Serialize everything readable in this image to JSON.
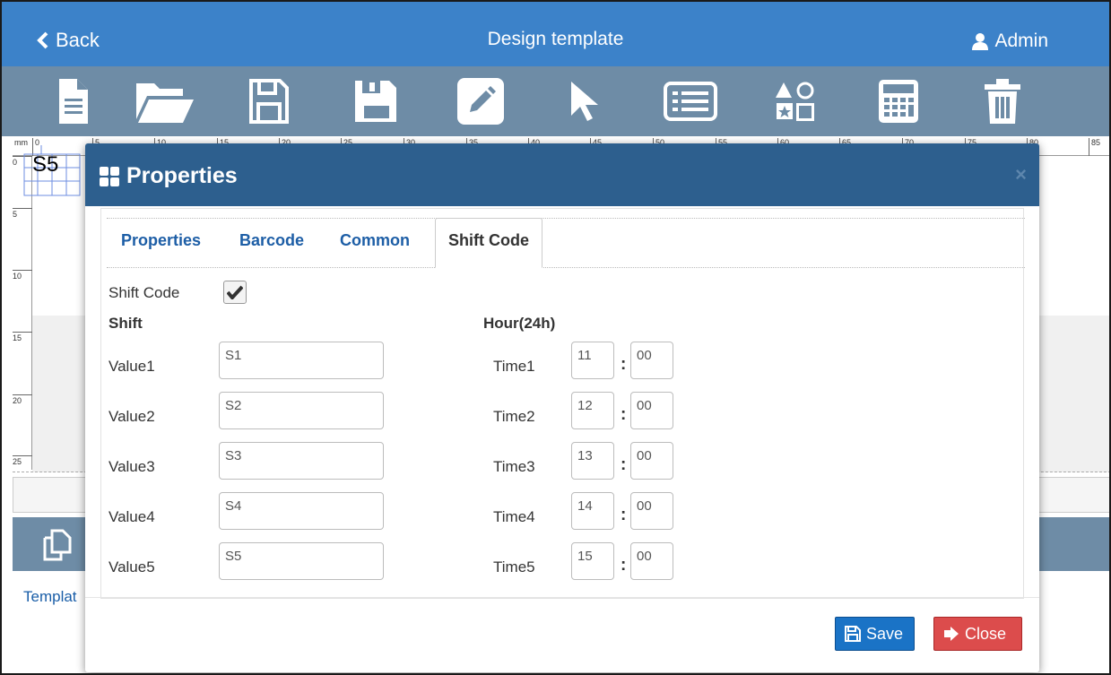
{
  "header": {
    "back_label": "Back",
    "title": "Design template",
    "user_label": "Admin"
  },
  "colors": {
    "header_bg": "#3c82c9",
    "toolbar_bg": "#6e8ca6",
    "modal_header_bg": "#2d5f8e",
    "link": "#1d5ea6",
    "save_bg": "#1a73c6",
    "close_bg": "#dc4c4c"
  },
  "toolbar": {
    "icons": [
      "file-icon",
      "folder-open-icon",
      "save-icon",
      "save-as-icon",
      "edit-icon",
      "pointer-icon",
      "list-icon",
      "shapes-icon",
      "calculator-icon",
      "trash-icon"
    ]
  },
  "ruler": {
    "unit": "mm",
    "top_ticks": [
      "0",
      "5",
      "10",
      "15",
      "20",
      "25",
      "30",
      "35",
      "40",
      "45",
      "50",
      "55",
      "60",
      "65",
      "70",
      "75",
      "80",
      "85"
    ],
    "left_ticks": [
      "0",
      "5",
      "10",
      "15",
      "20",
      "25"
    ]
  },
  "canvas": {
    "object_text": "S5"
  },
  "footer": {
    "template_link": "Templat"
  },
  "modal": {
    "title": "Properties",
    "close_glyph": "×",
    "tabs": [
      "Properties",
      "Barcode",
      "Common",
      "Shift Code"
    ],
    "active_tab": "Shift Code",
    "shift_code_label": "Shift Code",
    "shift_code_checked": true,
    "shift_header": "Shift",
    "hour_header": "Hour(24h)",
    "rows": [
      {
        "value_label": "Value1",
        "value": "S1",
        "time_label": "Time1",
        "hour": "11",
        "minute": "00"
      },
      {
        "value_label": "Value2",
        "value": "S2",
        "time_label": "Time2",
        "hour": "12",
        "minute": "00"
      },
      {
        "value_label": "Value3",
        "value": "S3",
        "time_label": "Time3",
        "hour": "13",
        "minute": "00"
      },
      {
        "value_label": "Value4",
        "value": "S4",
        "time_label": "Time4",
        "hour": "14",
        "minute": "00"
      },
      {
        "value_label": "Value5",
        "value": "S5",
        "time_label": "Time5",
        "hour": "15",
        "minute": "00"
      }
    ],
    "colon": ":",
    "save_label": "Save",
    "close_label": "Close"
  }
}
